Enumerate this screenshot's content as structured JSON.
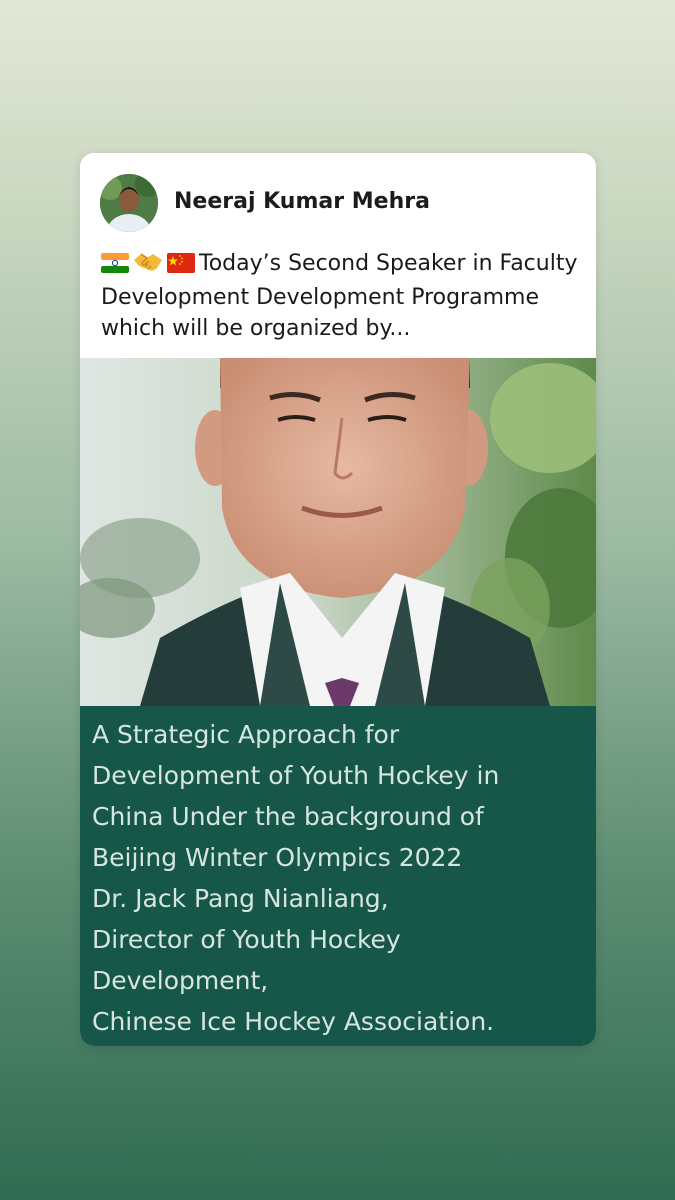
{
  "post": {
    "author": "Neeraj Kumar Mehra",
    "text": "Today’s Second Speaker in Faculty Development Development Programme which will be organized by...",
    "emoji_prefix": [
      "india-flag",
      "handshake",
      "china-flag"
    ]
  },
  "caption": {
    "lines": [
      "A Strategic Approach for",
      "Development of Youth Hockey in",
      "China Under the background of",
      "Beijing Winter Olympics 2022",
      "Dr. Jack Pang Nianliang,",
      "Director of Youth Hockey",
      "Development,",
      "Chinese Ice Hockey Association."
    ]
  },
  "colors": {
    "caption_bg": "#17574a",
    "caption_text": "#d6e6df"
  }
}
